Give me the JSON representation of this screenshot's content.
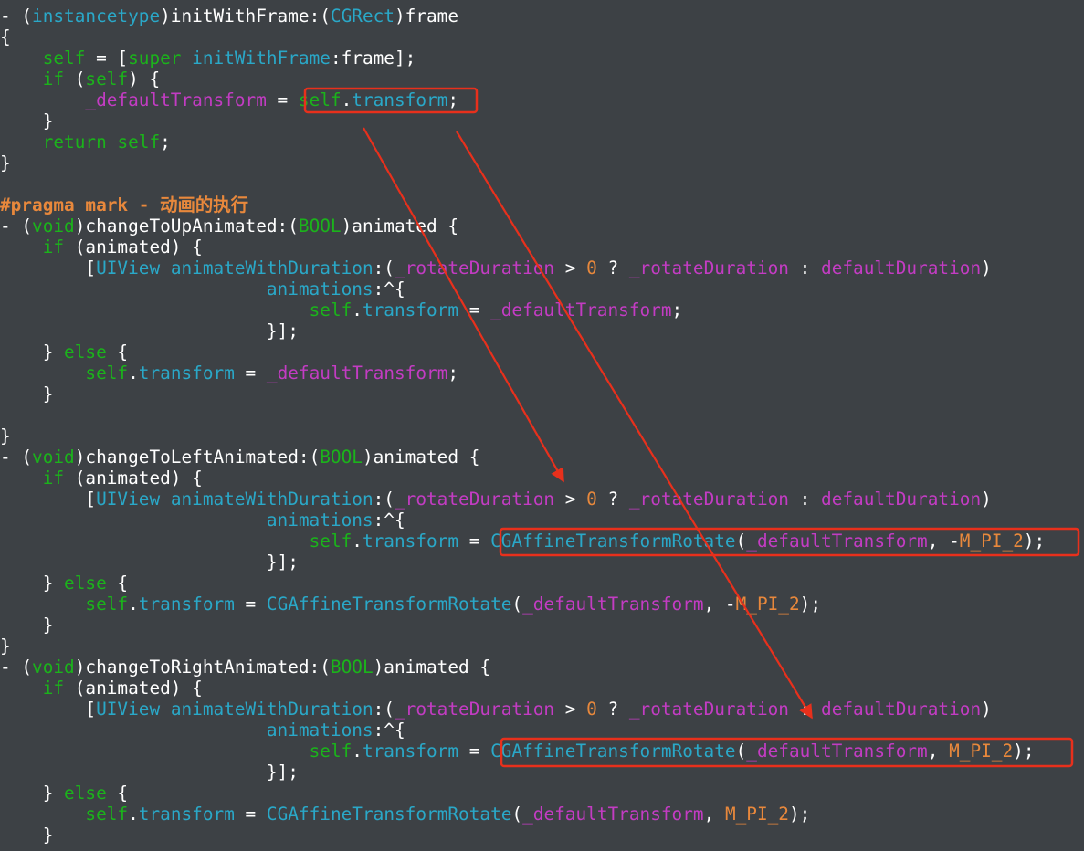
{
  "theme": {
    "background": "#3d4145",
    "plain": "#ffffff",
    "keyword": "#1bb31b",
    "type": "#2aa8c8",
    "method": "#2aa8c8",
    "ivar": "#c33cc3",
    "number": "#e8883c",
    "pragma": "#e8883c",
    "annotation": "#e8301c"
  },
  "code": {
    "lines": [
      [
        [
          "p",
          "- ("
        ],
        [
          "t",
          "instancetype"
        ],
        [
          "p",
          ")initWithFrame:("
        ],
        [
          "t",
          "CGRect"
        ],
        [
          "p",
          ")frame"
        ]
      ],
      [
        [
          "p",
          "{"
        ]
      ],
      [
        [
          "p",
          "    "
        ],
        [
          "k",
          "self"
        ],
        [
          "p",
          " = ["
        ],
        [
          "k",
          "super"
        ],
        [
          "p",
          " "
        ],
        [
          "m",
          "initWithFrame"
        ],
        [
          "p",
          ":frame];"
        ]
      ],
      [
        [
          "p",
          "    "
        ],
        [
          "k",
          "if"
        ],
        [
          "p",
          " ("
        ],
        [
          "k",
          "self"
        ],
        [
          "p",
          ") {"
        ]
      ],
      [
        [
          "p",
          "        "
        ],
        [
          "i",
          "_defaultTransform"
        ],
        [
          "p",
          " = "
        ],
        [
          "k",
          "self"
        ],
        [
          "p",
          "."
        ],
        [
          "m",
          "transform"
        ],
        [
          "p",
          ";"
        ]
      ],
      [
        [
          "p",
          "    }"
        ]
      ],
      [
        [
          "p",
          "    "
        ],
        [
          "k",
          "return"
        ],
        [
          "p",
          " "
        ],
        [
          "k",
          "self"
        ],
        [
          "p",
          ";"
        ]
      ],
      [
        [
          "p",
          "}"
        ]
      ],
      [],
      [
        [
          "c",
          "#pragma mark - 动画的执行"
        ]
      ],
      [
        [
          "p",
          "- ("
        ],
        [
          "k",
          "void"
        ],
        [
          "p",
          ")changeToUpAnimated:("
        ],
        [
          "k",
          "BOOL"
        ],
        [
          "p",
          ")animated {"
        ]
      ],
      [
        [
          "p",
          "    "
        ],
        [
          "k",
          "if"
        ],
        [
          "p",
          " (animated) {"
        ]
      ],
      [
        [
          "p",
          "        ["
        ],
        [
          "t",
          "UIView"
        ],
        [
          "p",
          " "
        ],
        [
          "m",
          "animateWithDuration"
        ],
        [
          "p",
          ":("
        ],
        [
          "i",
          "_rotateDuration"
        ],
        [
          "p",
          " > "
        ],
        [
          "n",
          "0"
        ],
        [
          "p",
          " ? "
        ],
        [
          "i",
          "_rotateDuration"
        ],
        [
          "p",
          " : "
        ],
        [
          "i",
          "defaultDuration"
        ],
        [
          "p",
          ")"
        ]
      ],
      [
        [
          "p",
          "                         "
        ],
        [
          "m",
          "animations"
        ],
        [
          "p",
          ":^{"
        ]
      ],
      [
        [
          "p",
          "                             "
        ],
        [
          "k",
          "self"
        ],
        [
          "p",
          "."
        ],
        [
          "m",
          "transform"
        ],
        [
          "p",
          " = "
        ],
        [
          "i",
          "_defaultTransform"
        ],
        [
          "p",
          ";"
        ]
      ],
      [
        [
          "p",
          "                         }];"
        ]
      ],
      [
        [
          "p",
          "    } "
        ],
        [
          "k",
          "else"
        ],
        [
          "p",
          " {"
        ]
      ],
      [
        [
          "p",
          "        "
        ],
        [
          "k",
          "self"
        ],
        [
          "p",
          "."
        ],
        [
          "m",
          "transform"
        ],
        [
          "p",
          " = "
        ],
        [
          "i",
          "_defaultTransform"
        ],
        [
          "p",
          ";"
        ]
      ],
      [
        [
          "p",
          "    }"
        ]
      ],
      [],
      [
        [
          "p",
          "}"
        ]
      ],
      [
        [
          "p",
          "- ("
        ],
        [
          "k",
          "void"
        ],
        [
          "p",
          ")changeToLeftAnimated:("
        ],
        [
          "k",
          "BOOL"
        ],
        [
          "p",
          ")animated {"
        ]
      ],
      [
        [
          "p",
          "    "
        ],
        [
          "k",
          "if"
        ],
        [
          "p",
          " (animated) {"
        ]
      ],
      [
        [
          "p",
          "        ["
        ],
        [
          "t",
          "UIView"
        ],
        [
          "p",
          " "
        ],
        [
          "m",
          "animateWithDuration"
        ],
        [
          "p",
          ":("
        ],
        [
          "i",
          "_rotateDuration"
        ],
        [
          "p",
          " > "
        ],
        [
          "n",
          "0"
        ],
        [
          "p",
          " ? "
        ],
        [
          "i",
          "_rotateDuration"
        ],
        [
          "p",
          " : "
        ],
        [
          "i",
          "defaultDuration"
        ],
        [
          "p",
          ")"
        ]
      ],
      [
        [
          "p",
          "                         "
        ],
        [
          "m",
          "animations"
        ],
        [
          "p",
          ":^{"
        ]
      ],
      [
        [
          "p",
          "                             "
        ],
        [
          "k",
          "self"
        ],
        [
          "p",
          "."
        ],
        [
          "m",
          "transform"
        ],
        [
          "p",
          " = "
        ],
        [
          "m",
          "CGAffineTransformRotate"
        ],
        [
          "p",
          "("
        ],
        [
          "i",
          "_defaultTransform"
        ],
        [
          "p",
          ", -"
        ],
        [
          "n",
          "M_PI_2"
        ],
        [
          "p",
          ");"
        ]
      ],
      [
        [
          "p",
          "                         }];"
        ]
      ],
      [
        [
          "p",
          "    } "
        ],
        [
          "k",
          "else"
        ],
        [
          "p",
          " {"
        ]
      ],
      [
        [
          "p",
          "        "
        ],
        [
          "k",
          "self"
        ],
        [
          "p",
          "."
        ],
        [
          "m",
          "transform"
        ],
        [
          "p",
          " = "
        ],
        [
          "m",
          "CGAffineTransformRotate"
        ],
        [
          "p",
          "("
        ],
        [
          "i",
          "_defaultTransform"
        ],
        [
          "p",
          ", -"
        ],
        [
          "n",
          "M_PI_2"
        ],
        [
          "p",
          ");"
        ]
      ],
      [
        [
          "p",
          "    }"
        ]
      ],
      [
        [
          "p",
          "}"
        ]
      ],
      [
        [
          "p",
          "- ("
        ],
        [
          "k",
          "void"
        ],
        [
          "p",
          ")changeToRightAnimated:("
        ],
        [
          "k",
          "BOOL"
        ],
        [
          "p",
          ")animated {"
        ]
      ],
      [
        [
          "p",
          "    "
        ],
        [
          "k",
          "if"
        ],
        [
          "p",
          " (animated) {"
        ]
      ],
      [
        [
          "p",
          "        ["
        ],
        [
          "t",
          "UIView"
        ],
        [
          "p",
          " "
        ],
        [
          "m",
          "animateWithDuration"
        ],
        [
          "p",
          ":("
        ],
        [
          "i",
          "_rotateDuration"
        ],
        [
          "p",
          " > "
        ],
        [
          "n",
          "0"
        ],
        [
          "p",
          " ? "
        ],
        [
          "i",
          "_rotateDuration"
        ],
        [
          "p",
          " : "
        ],
        [
          "i",
          "defaultDuration"
        ],
        [
          "p",
          ")"
        ]
      ],
      [
        [
          "p",
          "                         "
        ],
        [
          "m",
          "animations"
        ],
        [
          "p",
          ":^{"
        ]
      ],
      [
        [
          "p",
          "                             "
        ],
        [
          "k",
          "self"
        ],
        [
          "p",
          "."
        ],
        [
          "m",
          "transform"
        ],
        [
          "p",
          " = "
        ],
        [
          "m",
          "CGAffineTransformRotate"
        ],
        [
          "p",
          "("
        ],
        [
          "i",
          "_defaultTransform"
        ],
        [
          "p",
          ", "
        ],
        [
          "n",
          "M_PI_2"
        ],
        [
          "p",
          ");"
        ]
      ],
      [
        [
          "p",
          "                         }];"
        ]
      ],
      [
        [
          "p",
          "    } "
        ],
        [
          "k",
          "else"
        ],
        [
          "p",
          " {"
        ]
      ],
      [
        [
          "p",
          "        "
        ],
        [
          "k",
          "self"
        ],
        [
          "p",
          "."
        ],
        [
          "m",
          "transform"
        ],
        [
          "p",
          " = "
        ],
        [
          "m",
          "CGAffineTransformRotate"
        ],
        [
          "p",
          "("
        ],
        [
          "i",
          "_defaultTransform"
        ],
        [
          "p",
          ", "
        ],
        [
          "n",
          "M_PI_2"
        ],
        [
          "p",
          ");"
        ]
      ],
      [
        [
          "p",
          "    }"
        ]
      ]
    ]
  }
}
